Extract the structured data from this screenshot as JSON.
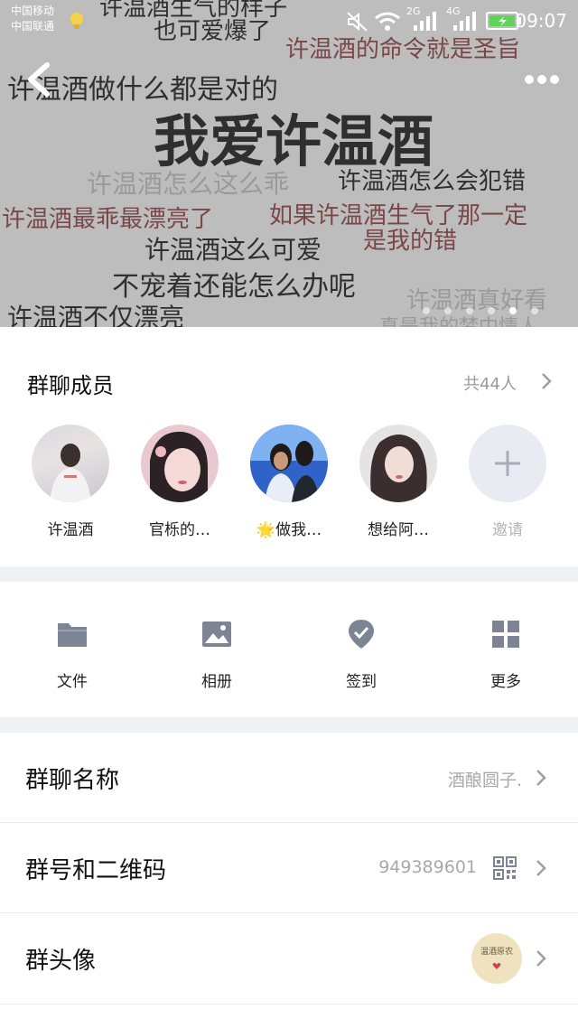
{
  "status_bar": {
    "carrier_1": "中国移动",
    "carrier_2": "中国联通",
    "network_1": "2G",
    "network_2": "4G",
    "time": "09:07"
  },
  "banner": {
    "headline": "我爱许温酒",
    "lines": [
      "许温酒生气的样子",
      "也可爱爆了",
      "许温酒的命令就是圣旨",
      "许温酒做什么都是对的",
      "许温酒怎么这么乖",
      "许温酒怎么会犯错",
      "许温酒最乖最漂亮了",
      "如果许温酒生气了那一定",
      "许温酒这么可爱",
      "是我的错",
      "不宠着还能怎么办呢",
      "许温酒真好看",
      "许温酒不仅漂亮",
      "真是我的梦中情人"
    ],
    "page_count": 6,
    "active_page": 5
  },
  "members": {
    "title": "群聊成员",
    "count_label": "共44人",
    "list": [
      {
        "name": "许温酒"
      },
      {
        "name": "官栎的…"
      },
      {
        "name": "🌟做我…"
      },
      {
        "name": "想给阿…"
      }
    ],
    "invite_label": "邀请"
  },
  "tools": [
    {
      "label": "文件",
      "icon": "folder-icon"
    },
    {
      "label": "相册",
      "icon": "image-icon"
    },
    {
      "label": "签到",
      "icon": "checkin-icon"
    },
    {
      "label": "更多",
      "icon": "grid-icon"
    }
  ],
  "settings": {
    "group_name_label": "群聊名称",
    "group_name_value": "酒酿圆子.",
    "group_id_label": "群号和二维码",
    "group_id_value": "949389601",
    "group_avatar_label": "群头像",
    "group_avatar_text": "温酒原农"
  },
  "colors": {
    "banner_bg": "#bdbdbd",
    "icon_color": "#7d8595",
    "secondary_text": "#a8a8a8",
    "separator_bg": "#f0f1f5"
  }
}
